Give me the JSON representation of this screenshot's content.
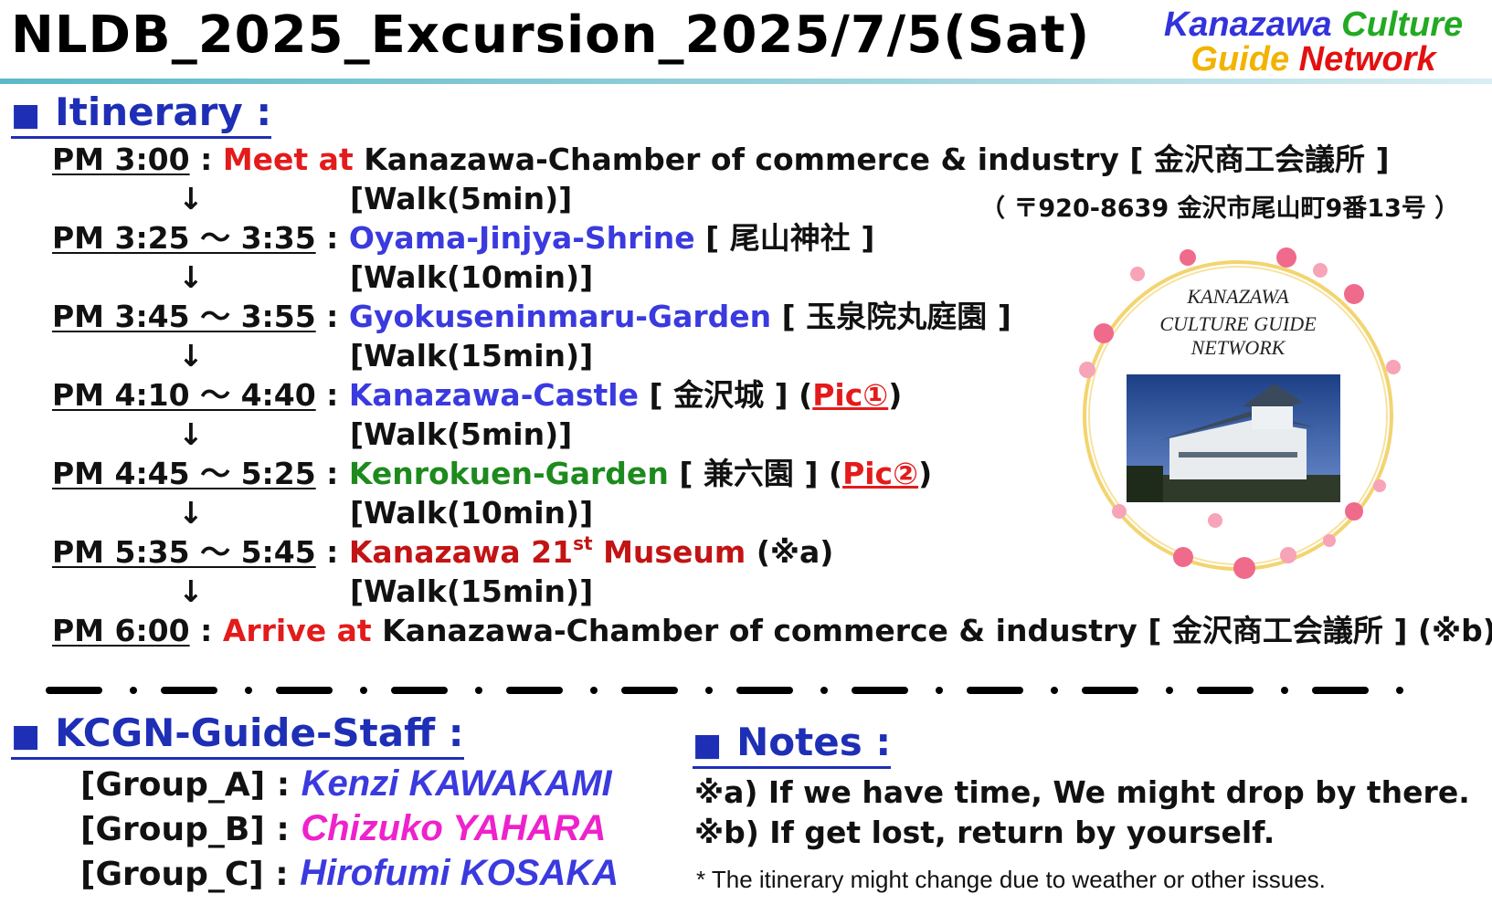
{
  "header": {
    "title": "NLDB_2025_Excursion_2025/7/5(Sat)",
    "org_line1_a": "Kanazawa",
    "org_line1_b": "Culture",
    "org_line2_a": "Guide",
    "org_line2_b": "Network"
  },
  "itinerary": {
    "heading": "Itinerary :",
    "address": "（ 〒920-8639 金沢市尾山町9番13号 ）",
    "stops": [
      {
        "time": "PM 3:00",
        "prefix": "Meet at",
        "place": "Kanazawa-Chamber of commerce & industry",
        "jp": "[ 金沢商工会議所 ]",
        "extra": ""
      },
      {
        "time": "PM 3:25 ～ 3:35",
        "place": "Oyama-Jinjya-Shrine",
        "jp": "[ 尾山神社 ]"
      },
      {
        "time": "PM 3:45 ～ 3:55",
        "place": "Gyokuseninmaru-Garden",
        "jp": "[ 玉泉院丸庭園 ]"
      },
      {
        "time": "PM 4:10 ～ 4:40",
        "place": "Kanazawa-Castle",
        "jp": "[ 金沢城 ]",
        "pic": "Pic①"
      },
      {
        "time": "PM 4:45 ～ 5:25",
        "place": "Kenrokuen-Garden",
        "jp": "[ 兼六園 ]",
        "pic": "Pic②"
      },
      {
        "time": "PM 5:35 ～ 5:45",
        "place_a": "Kanazawa 21",
        "place_sup": "st",
        "place_b": " Museum",
        "extra": "(※a)"
      },
      {
        "time": "PM 6:00",
        "prefix": "Arrive at",
        "place": "Kanazawa-Chamber of commerce & industry",
        "jp": "[ 金沢商工会議所 ]",
        "extra": "(※b)"
      }
    ],
    "walks": [
      "[Walk(5min)]",
      "[Walk(10min)]",
      "[Walk(15min)]",
      "[Walk(5min)]",
      "[Walk(10min)]",
      "[Walk(15min)]"
    ],
    "arrow": "↓",
    "sep": ":"
  },
  "logo": {
    "line1": "KANAZAWA",
    "line2": "CULTURE GUIDE",
    "line3": "NETWORK"
  },
  "staff": {
    "heading": "KCGN-Guide-Staff :",
    "members": [
      {
        "group": "[Group_A]",
        "name": "Kenzi KAWAKAMI",
        "color": "#3a3adf"
      },
      {
        "group": "[Group_B]",
        "name": "Chizuko YAHARA",
        "color": "#ee22cc"
      },
      {
        "group": "[Group_C]",
        "name": "Hirofumi KOSAKA",
        "color": "#3a3adf"
      }
    ]
  },
  "notes": {
    "heading": "Notes :",
    "items": [
      "※a) If we have time, We might drop by there.",
      "※b) If get lost, return by yourself."
    ],
    "footnote": "* The itinerary might change due to weather or other issues."
  }
}
